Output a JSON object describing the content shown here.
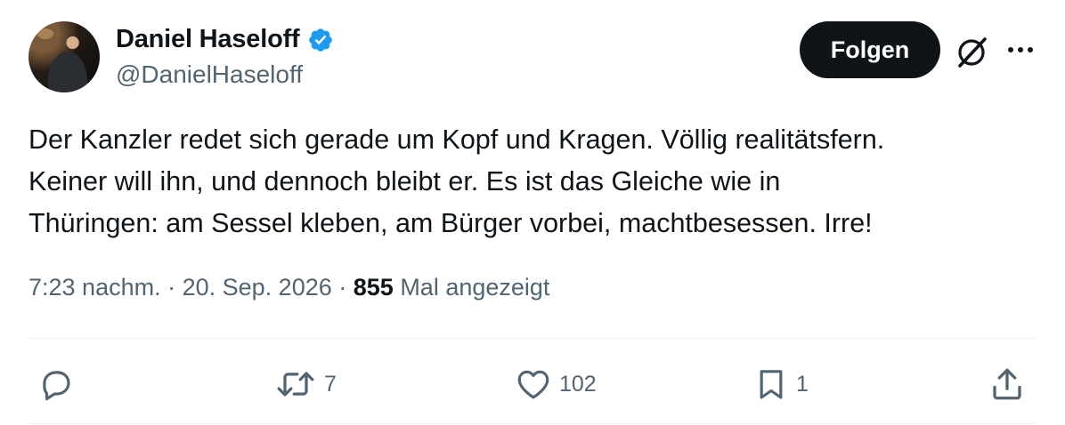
{
  "author": {
    "display_name": "Daniel Haseloff",
    "handle": "@DanielHaseloff",
    "verified_color": "#1d9bf0"
  },
  "header": {
    "follow_label": "Folgen",
    "grok_icon": "grok-icon",
    "more_icon": "more-dots-icon"
  },
  "tweet": {
    "lines": [
      "Der Kanzler redet sich gerade um Kopf und Kragen. Völlig realitätsfern.",
      "Keiner will ihn, und dennoch bleibt er. Es ist das Gleiche wie in",
      "Thüringen: am Sessel kleben, am Bürger vorbei, machtbesessen. Irre!"
    ]
  },
  "meta": {
    "time": "7:23 nachm.",
    "separator1": " · ",
    "date": "20. Sep. 2026",
    "separator2": " · ",
    "views_count": "855",
    "views_label": " Mal angezeigt"
  },
  "actions": {
    "reply_count": "",
    "retweet_count": "7",
    "like_count": "102",
    "bookmark_count": "1"
  },
  "colors": {
    "text": "#0f1419",
    "secondary": "#536471",
    "divider": "#eff3f4",
    "button_bg": "#0f1419"
  }
}
